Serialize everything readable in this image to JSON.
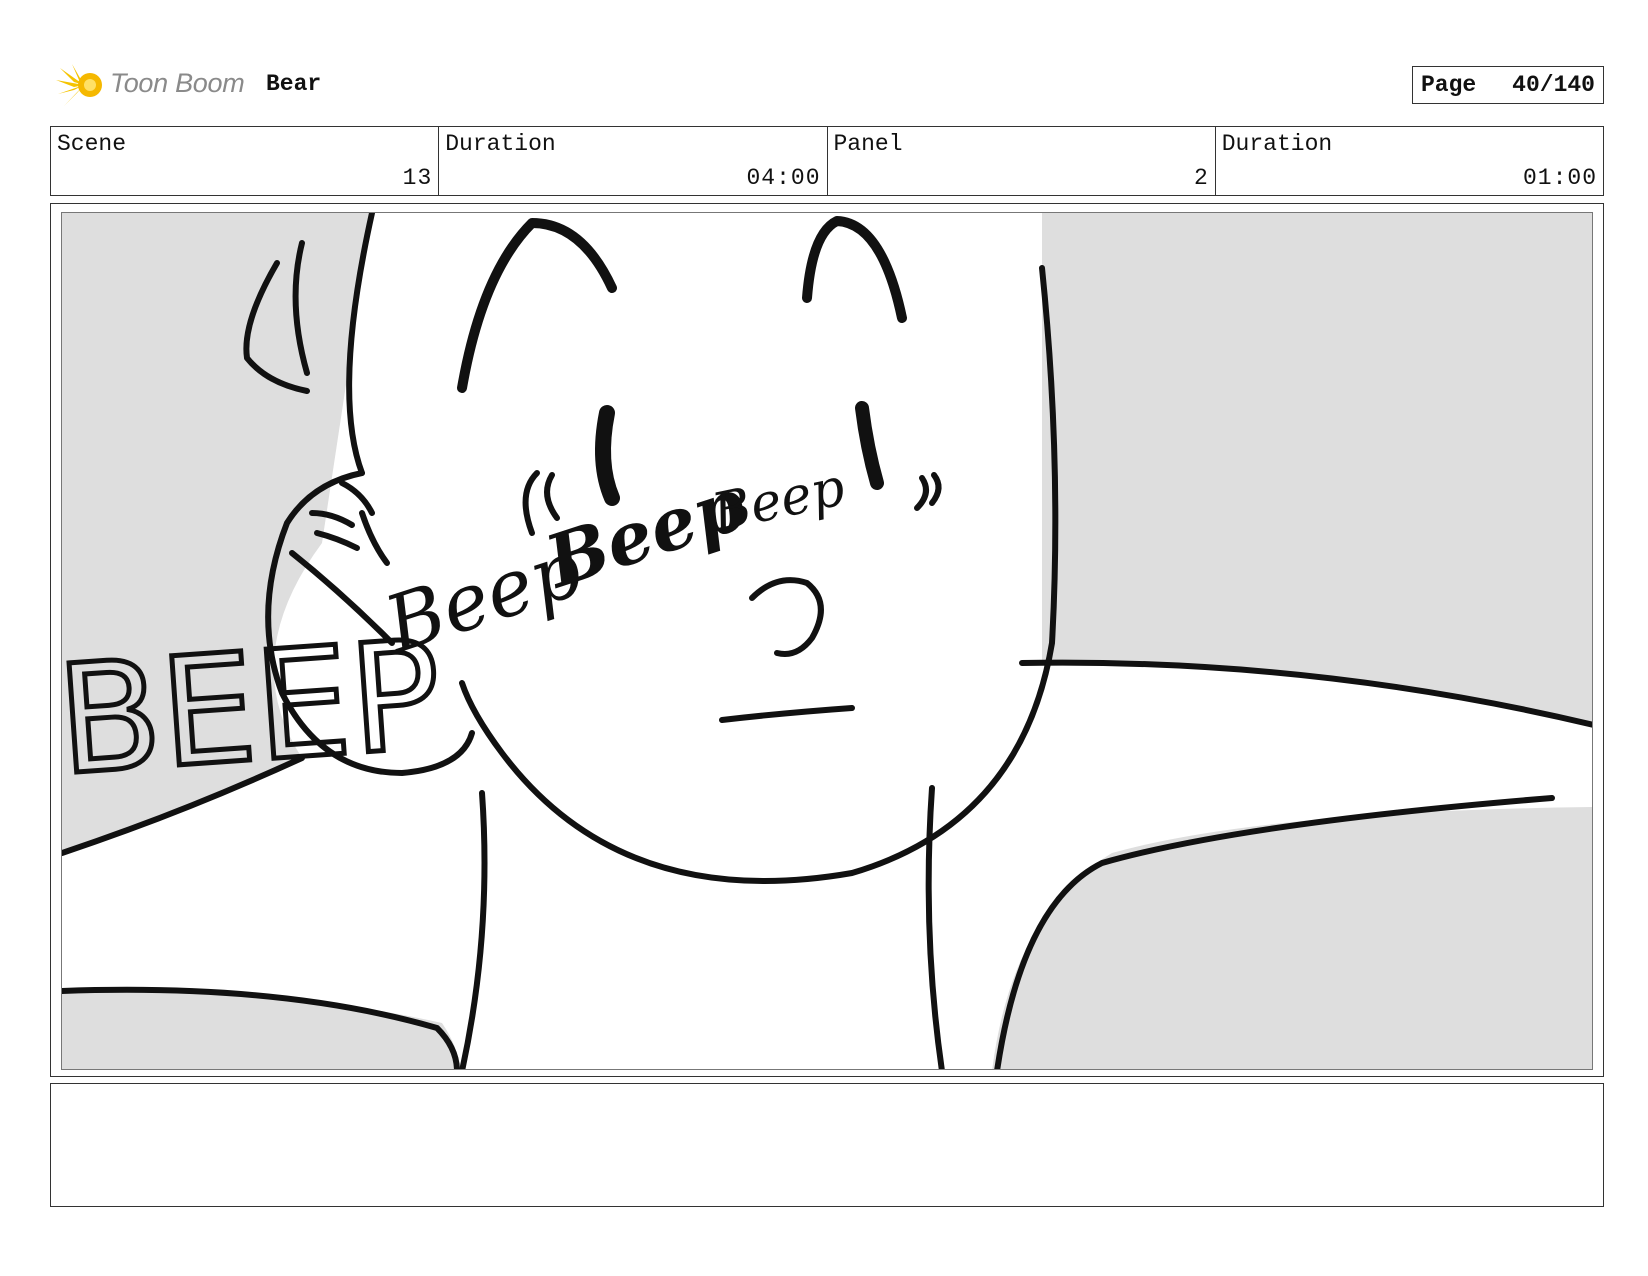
{
  "header": {
    "brand": "Toon Boom",
    "project": "Bear",
    "page_label": "Page",
    "page_value": "40/140"
  },
  "info": [
    {
      "label": "Scene",
      "value": "13"
    },
    {
      "label": "Duration",
      "value": "04:00"
    },
    {
      "label": "Panel",
      "value": "2"
    },
    {
      "label": "Duration",
      "value": "01:00"
    }
  ],
  "panel": {
    "sfx_big": "BEEP",
    "sfx_1": "Beep",
    "sfx_2": "Beep",
    "sfx_3": "Beep"
  },
  "notes": {
    "text": ""
  }
}
